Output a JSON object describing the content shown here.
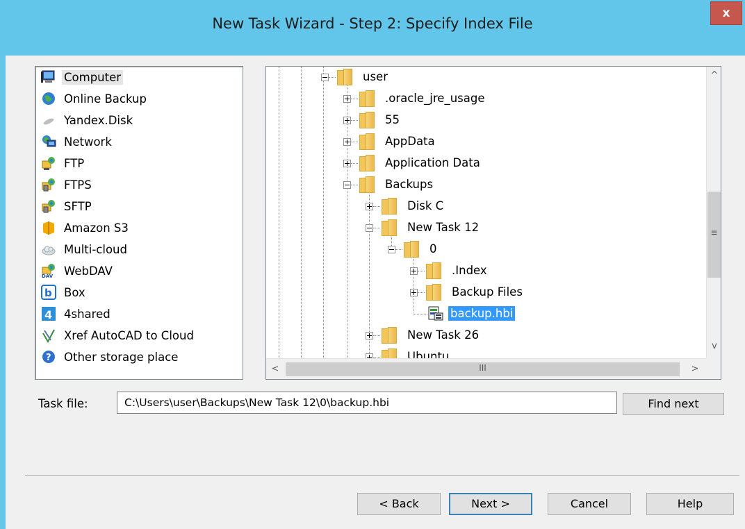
{
  "window": {
    "title": "New Task Wizard - Step 2: Specify Index File",
    "close_glyph": "x"
  },
  "storage_list": {
    "selected": "Computer",
    "items": [
      {
        "label": "Computer",
        "icon": "computer-icon"
      },
      {
        "label": "Online Backup",
        "icon": "globe-icon"
      },
      {
        "label": "Yandex.Disk",
        "icon": "yandex-disk-icon"
      },
      {
        "label": "Network",
        "icon": "network-icon"
      },
      {
        "label": "FTP",
        "icon": "ftp-icon"
      },
      {
        "label": "FTPS",
        "icon": "ftps-icon"
      },
      {
        "label": "SFTP",
        "icon": "sftp-icon"
      },
      {
        "label": "Amazon S3",
        "icon": "amazon-s3-icon"
      },
      {
        "label": "Multi-cloud",
        "icon": "cloud-icon"
      },
      {
        "label": "WebDAV",
        "icon": "webdav-icon"
      },
      {
        "label": "Box",
        "icon": "box-icon"
      },
      {
        "label": "4shared",
        "icon": "4shared-icon"
      },
      {
        "label": "Xref AutoCAD to Cloud",
        "icon": "xref-icon"
      },
      {
        "label": "Other storage place",
        "icon": "question-icon"
      }
    ]
  },
  "tree": {
    "nodes": [
      {
        "label": "user",
        "expander": "minus"
      },
      {
        "label": ".oracle_jre_usage",
        "expander": "plus"
      },
      {
        "label": "55",
        "expander": "plus"
      },
      {
        "label": "AppData",
        "expander": "plus"
      },
      {
        "label": "Application Data",
        "expander": "plus"
      },
      {
        "label": "Backups",
        "expander": "minus"
      },
      {
        "label": "Disk C",
        "expander": "plus"
      },
      {
        "label": "New Task 12",
        "expander": "minus"
      },
      {
        "label": "0",
        "expander": "minus"
      },
      {
        "label": ".Index",
        "expander": "plus"
      },
      {
        "label": "Backup Files",
        "expander": "plus"
      },
      {
        "label": "backup.hbi",
        "expander": "none",
        "selected": true
      },
      {
        "label": "New Task 26",
        "expander": "plus"
      },
      {
        "label": "Ubuntu",
        "expander": "plus"
      }
    ],
    "scroll_up": "^",
    "scroll_down": "v",
    "scroll_left": "<",
    "scroll_right": ">",
    "grip_vertical": "≡",
    "grip_horizontal": "III"
  },
  "task_file": {
    "label": "Task file:",
    "value": "C:\\Users\\user\\Backups\\New Task 12\\0\\backup.hbi",
    "find_next_label": "Find next"
  },
  "buttons": {
    "back": "< Back",
    "next": "Next >",
    "cancel": "Cancel",
    "help": "Help"
  },
  "colors": {
    "title_bar": "#62c5ea",
    "close_button": "#c6574f",
    "selection": "#3399ff"
  }
}
